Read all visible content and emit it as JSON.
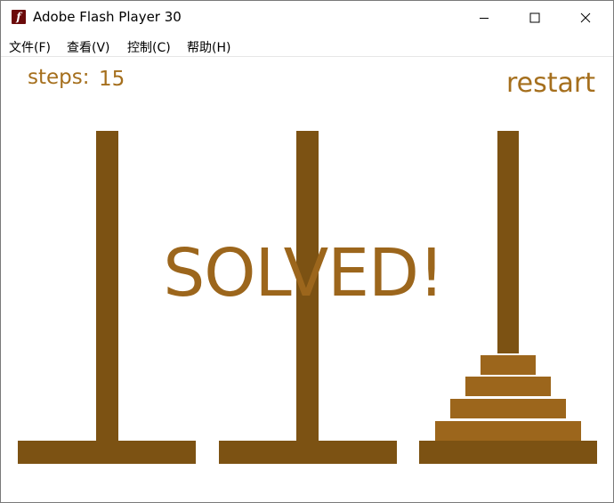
{
  "window": {
    "title": "Adobe Flash Player 30",
    "icon": "flash-player-icon",
    "icon_glyph": "f",
    "controls": [
      "minimize-icon",
      "maximize-icon",
      "close-icon"
    ]
  },
  "menu": {
    "items": [
      {
        "label": "文件(F)"
      },
      {
        "label": "查看(V)"
      },
      {
        "label": "控制(C)"
      },
      {
        "label": "帮助(H)"
      }
    ]
  },
  "game": {
    "steps_label": "steps:",
    "steps_value": "15",
    "restart_label": "restart",
    "status": "SOLVED!",
    "pegs": [
      {
        "disks": []
      },
      {
        "disks": []
      },
      {
        "disks": [
          1,
          2,
          3,
          4
        ]
      }
    ],
    "colors": {
      "text": "#a56f1d",
      "peg": "#7c5213",
      "disk": "#9c661c"
    }
  }
}
